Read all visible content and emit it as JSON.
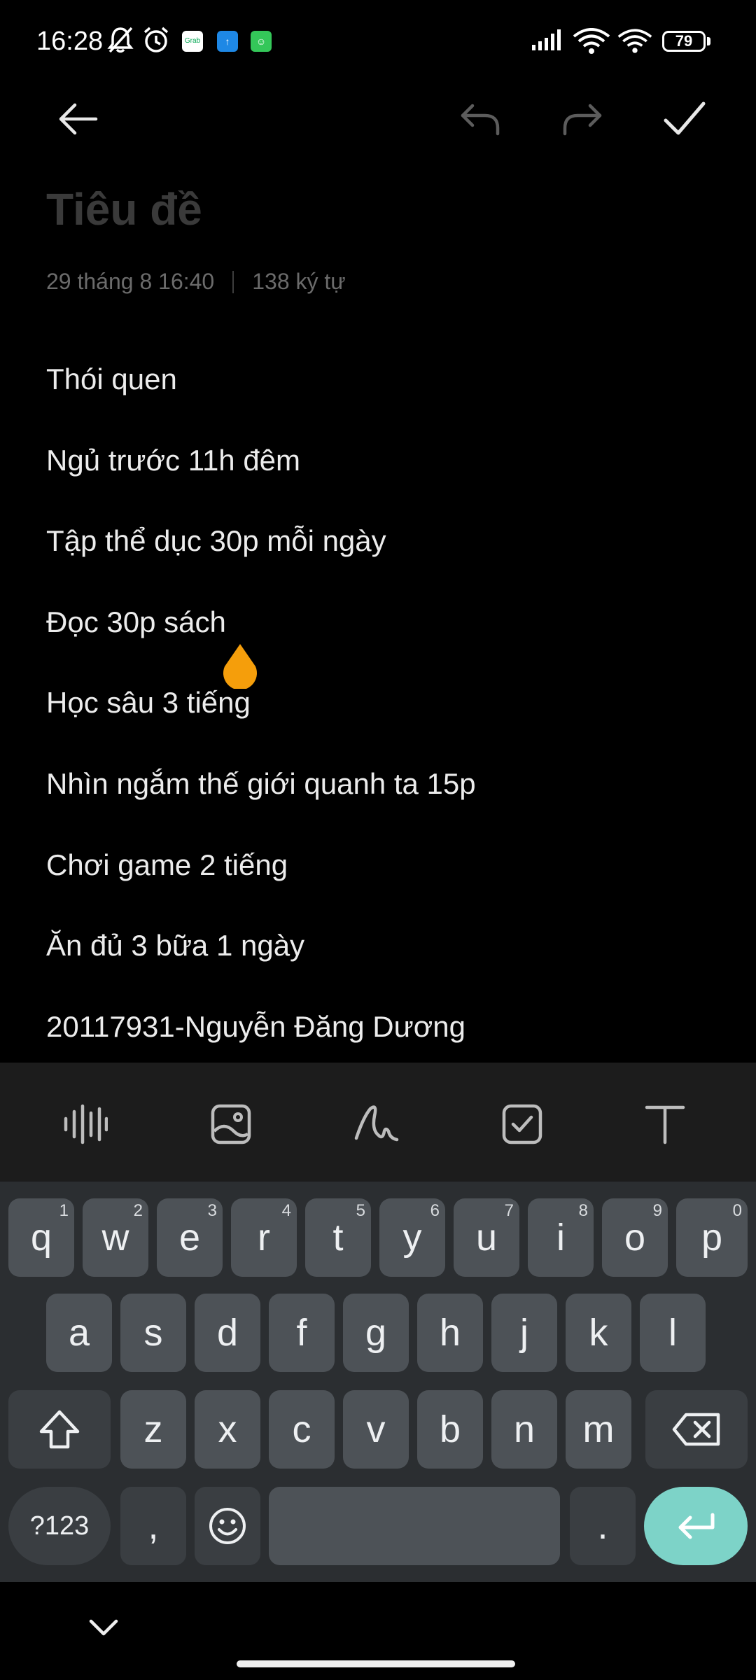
{
  "status_bar": {
    "time": "16:28",
    "icons": [
      "mute-bell-icon",
      "alarm-icon",
      "grab-app-icon",
      "upload-app-icon",
      "android-app-icon",
      "signal-icon",
      "wifi-icon",
      "wifi-icon",
      "battery-icon"
    ],
    "battery_level": "79"
  },
  "toolbar": {
    "back": "back-arrow-icon",
    "undo": "undo-icon",
    "redo": "redo-icon",
    "done": "check-icon"
  },
  "note": {
    "title_placeholder": "Tiêu đề",
    "date": "29 tháng 8 16:40",
    "char_count": "138 ký tự",
    "lines": [
      "Thói quen",
      "Ngủ trước 11h đêm",
      "Tập thể dục 30p mỗi ngày",
      "Đọc 30p sách",
      "Học sâu 3 tiếng",
      "Nhìn ngắm thế giới quanh ta 15p",
      "Chơi game 2 tiếng",
      "Ăn đủ 3 bữa 1 ngày",
      "20117931-Nguyễn Đăng Dương"
    ]
  },
  "format_bar": {
    "tools": [
      "audio-icon",
      "image-icon",
      "handwriting-icon",
      "checklist-icon",
      "text-format-icon"
    ]
  },
  "keyboard": {
    "row1": [
      {
        "key": "q",
        "hint": "1"
      },
      {
        "key": "w",
        "hint": "2"
      },
      {
        "key": "e",
        "hint": "3"
      },
      {
        "key": "r",
        "hint": "4"
      },
      {
        "key": "t",
        "hint": "5"
      },
      {
        "key": "y",
        "hint": "6"
      },
      {
        "key": "u",
        "hint": "7"
      },
      {
        "key": "i",
        "hint": "8"
      },
      {
        "key": "o",
        "hint": "9"
      },
      {
        "key": "p",
        "hint": "0"
      }
    ],
    "row2": [
      "a",
      "s",
      "d",
      "f",
      "g",
      "h",
      "j",
      "k",
      "l"
    ],
    "row3": [
      "z",
      "x",
      "c",
      "v",
      "b",
      "n",
      "m"
    ],
    "symbols_label": "?123",
    "comma": ",",
    "period": "."
  },
  "colors": {
    "accent_enter": "#7dd3c8",
    "cursor_handle": "#f59e0b"
  }
}
